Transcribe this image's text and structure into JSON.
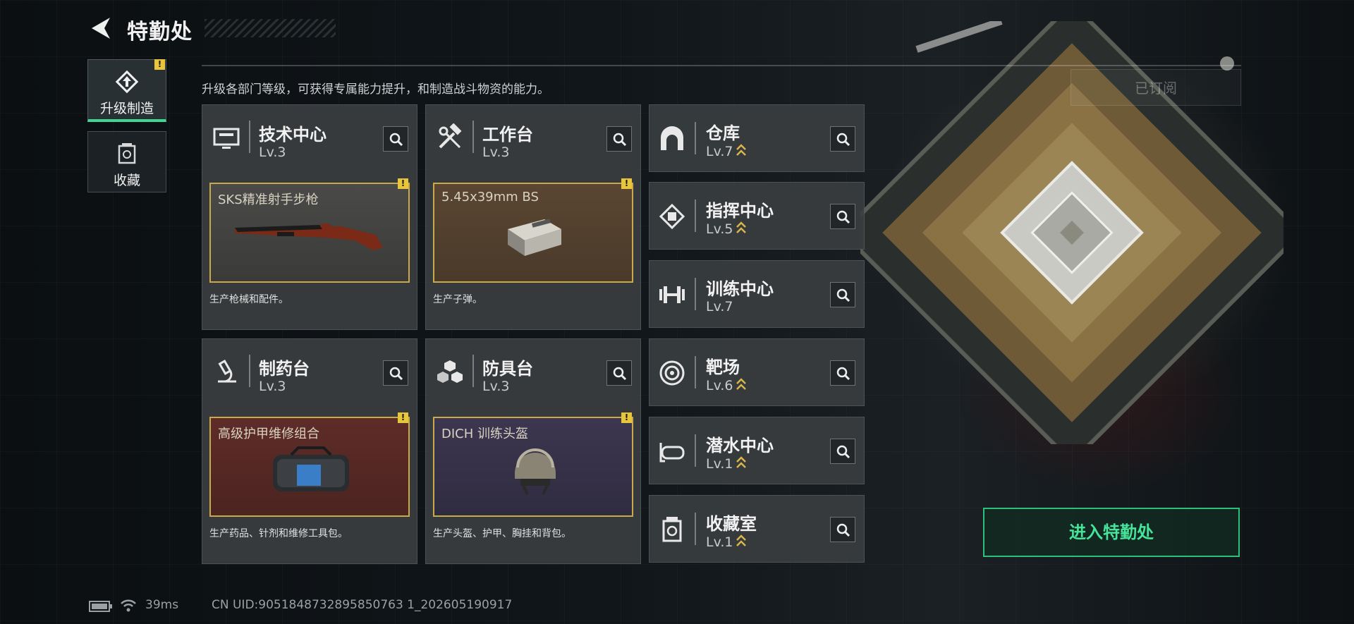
{
  "header": {
    "title": "特勤处"
  },
  "description": "升级各部门等级，可获得专属能力提升，和制造战斗物资的能力。",
  "sidebar": {
    "items": [
      {
        "label": "升级制造",
        "icon": "upgrade-icon",
        "active": true,
        "alert": "!"
      },
      {
        "label": "收藏",
        "icon": "collection-icon",
        "active": false
      }
    ]
  },
  "workshops": [
    {
      "name": "技术中心",
      "level": "Lv.3",
      "icon": "technology-monitor-icon",
      "product": {
        "name": "SKS精准射手步枪",
        "alert": "!",
        "desc": "生产枪械和配件。"
      }
    },
    {
      "name": "工作台",
      "level": "Lv.3",
      "icon": "hammer-wrench-icon",
      "product": {
        "name": "5.45x39mm BS",
        "alert": "!",
        "desc": "生产子弹。"
      }
    },
    {
      "name": "制药台",
      "level": "Lv.3",
      "icon": "microscope-icon",
      "product": {
        "name": "高级护甲维修组合",
        "alert": "!",
        "desc": "生产药品、针剂和维修工具包。"
      }
    },
    {
      "name": "防具台",
      "level": "Lv.3",
      "icon": "armor-blocks-icon",
      "product": {
        "name": "DICH 训练头盔",
        "alert": "!",
        "desc": "生产头盔、护甲、胸挂和背包。"
      }
    }
  ],
  "departments": [
    {
      "name": "仓库",
      "level": "Lv.7",
      "icon": "warehouse-icon",
      "upgradable": true
    },
    {
      "name": "指挥中心",
      "level": "Lv.5",
      "icon": "command-chip-icon",
      "upgradable": true
    },
    {
      "name": "训练中心",
      "level": "Lv.7",
      "icon": "dumbbell-icon",
      "upgradable": false
    },
    {
      "name": "靶场",
      "level": "Lv.6",
      "icon": "target-icon",
      "upgradable": true
    },
    {
      "name": "潜水中心",
      "level": "Lv.1",
      "icon": "diving-mask-icon",
      "upgradable": true
    },
    {
      "name": "收藏室",
      "level": "Lv.1",
      "icon": "trophy-case-icon",
      "upgradable": true
    }
  ],
  "subscribed_label": "已订阅",
  "enter_button": "进入特勤处",
  "status": {
    "ping": "39ms",
    "uid": "CN UID:9051848732895850763 1_202605190917"
  },
  "colors": {
    "accent_green": "#3ed595",
    "alert_yellow": "#e8c53a",
    "product_border": "#c9a94a"
  }
}
